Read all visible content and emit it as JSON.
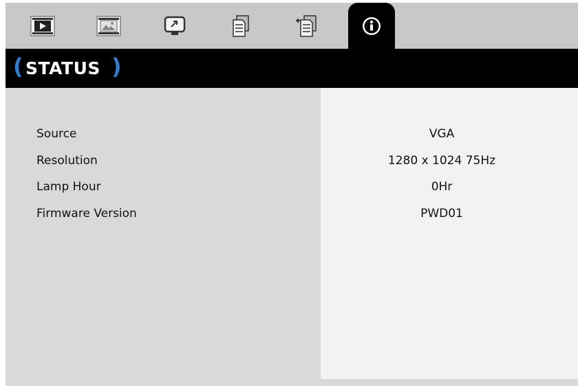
{
  "tabs": [
    {
      "icon": "image-settings-icon"
    },
    {
      "icon": "display-settings-icon"
    },
    {
      "icon": "setup-icon"
    },
    {
      "icon": "options-icon"
    },
    {
      "icon": "advanced-options-icon"
    },
    {
      "icon": "info-icon",
      "active": true
    }
  ],
  "header": {
    "open_paren": "(",
    "title": "STATUS",
    "close_paren": ")"
  },
  "rows": [
    {
      "label": "Source",
      "value": "VGA"
    },
    {
      "label": "Resolution",
      "value": "1280 x 1024 75Hz"
    },
    {
      "label": "Lamp Hour",
      "value": "0Hr"
    },
    {
      "label": "Firmware Version",
      "value": "PWD01"
    }
  ],
  "colors": {
    "accent": "#2e7dd1",
    "header_bg": "#000000",
    "tabbar_bg": "#c8c8c8",
    "left_bg": "#d9d9d9",
    "right_bg": "#f2f2f2"
  }
}
